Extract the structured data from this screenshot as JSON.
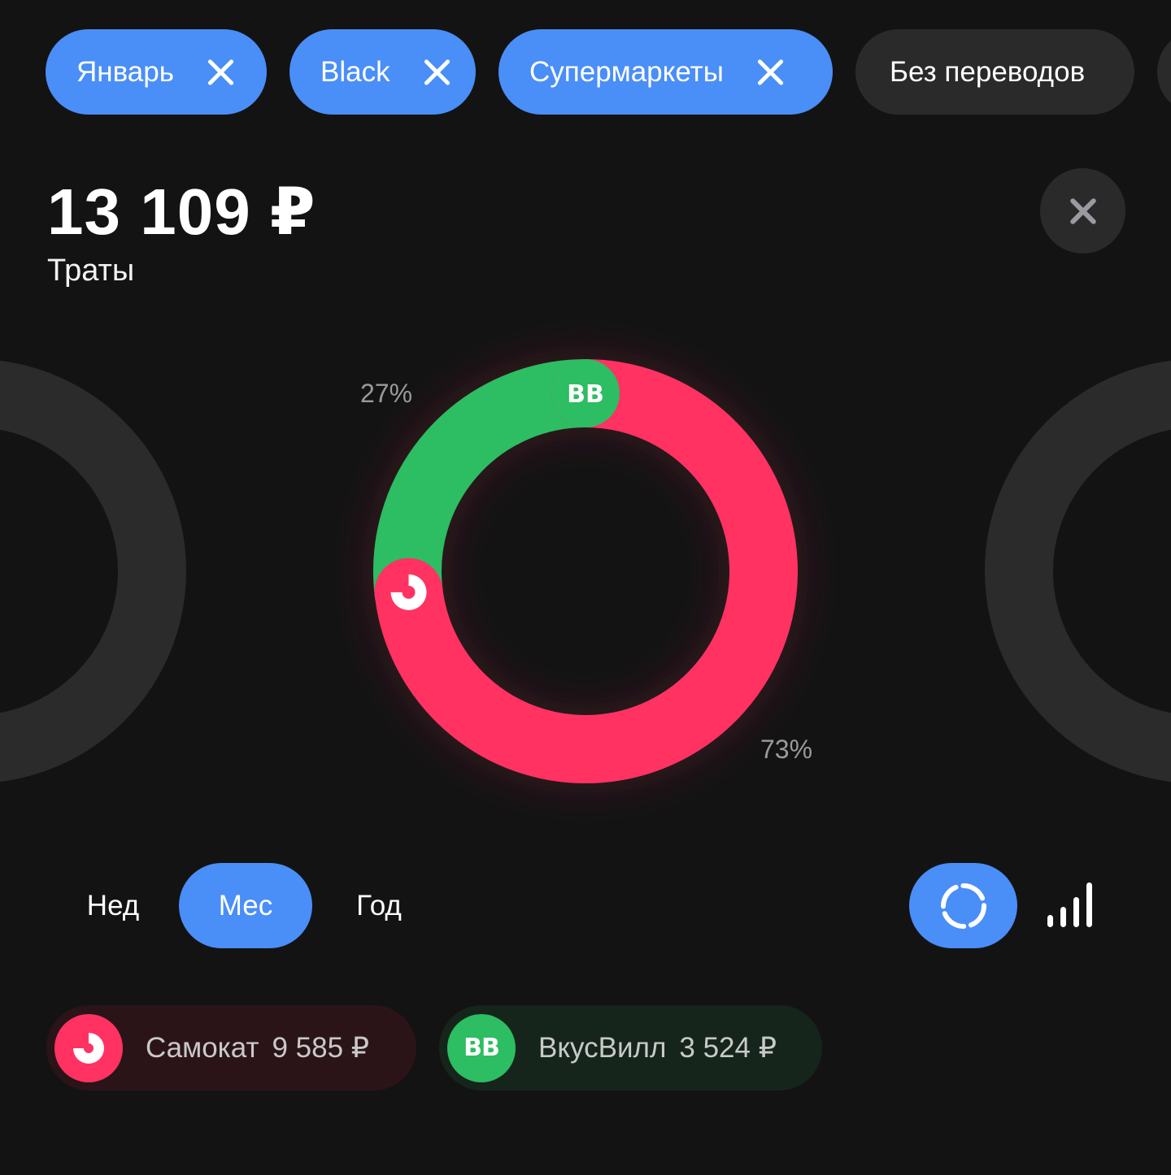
{
  "filters": {
    "chips": [
      {
        "label": "Январь",
        "active": true,
        "removable": true
      },
      {
        "label": "Black",
        "active": true,
        "removable": true
      },
      {
        "label": "Супермаркеты",
        "active": true,
        "removable": true
      },
      {
        "label": "Без переводов",
        "active": false,
        "removable": false
      }
    ]
  },
  "summary": {
    "amount": "13 109 ₽",
    "label": "Траты"
  },
  "chart_data": {
    "type": "pie",
    "donut": true,
    "categories": [
      "Самокат",
      "ВкусВилл"
    ],
    "values": [
      9585,
      3524
    ],
    "percent_labels": [
      "73%",
      "27%"
    ],
    "colors": [
      "#ff3262",
      "#2dbd62"
    ],
    "segment_badges": [
      "samokat-logo",
      "BB"
    ]
  },
  "period": {
    "options": [
      "Нед",
      "Мес",
      "Год"
    ],
    "selected": "Мес"
  },
  "view": {
    "donut_icon": "donut-chart-icon",
    "bars_icon": "bar-chart-icon",
    "selected": "donut"
  },
  "legend": [
    {
      "name": "Самокат",
      "value": "9 585 ₽",
      "color": "#ff3262",
      "bg": "#2b1418",
      "logo": "samokat-logo"
    },
    {
      "name": "ВкусВилл",
      "value": "3 524 ₽",
      "color": "#2dbd62",
      "bg": "#15251b",
      "logo": "BB"
    }
  ]
}
